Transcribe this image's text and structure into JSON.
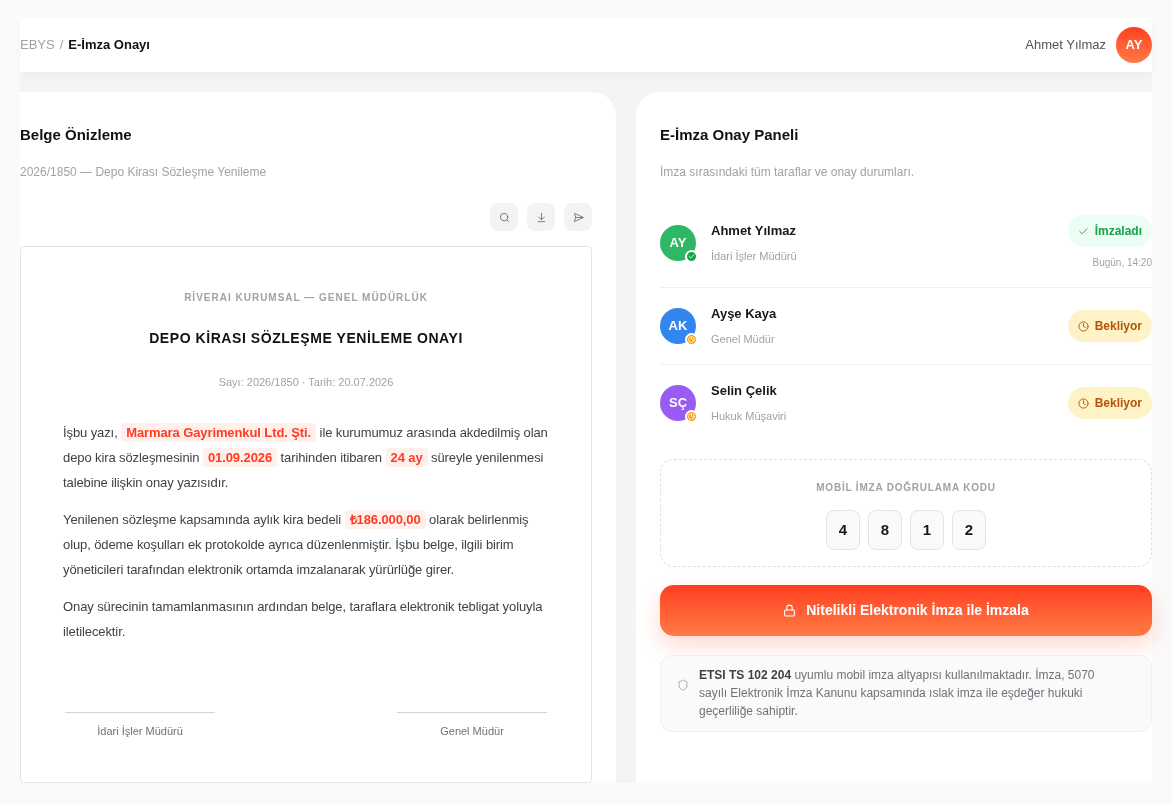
{
  "breadcrumb": {
    "root": "EBYS",
    "separator": "/",
    "current": "E-İmza Onayı"
  },
  "user": {
    "name": "Ahmet Yılmaz",
    "initials": "AY"
  },
  "preview": {
    "title": "Belge Önizleme",
    "subtitle": "2026/1850 — Depo Kirası Sözleşme Yenileme",
    "toolbar": [
      {
        "kind": "zoom"
      },
      {
        "kind": "download"
      },
      {
        "kind": "send"
      }
    ],
    "document": {
      "org": "RİVERAI KURUMSAL — GENEL MÜDÜRLÜK",
      "title": "DEPO KİRASI SÖZLEŞME YENİLEME ONAYI",
      "meta": "Sayı: 2026/1850 · Tarih: 20.07.2026",
      "paragraphs": [
        "İşbu yazı, **Marmara Gayrimenkul Ltd. Şti.** ile kurumumuz arasında akdedilmiş olan depo kira sözleşmesinin **01.09.2026** tarihinden itibaren **24 ay** süreyle yenilenmesi talebine ilişkin onay yazısıdır.",
        "Yenilenen sözleşme kapsamında aylık kira bedeli **₺186.000,00** olarak belirlenmiş olup, ödeme koşulları ek protokolde ayrıca düzenlenmiştir. İşbu belge, ilgili birim yöneticileri tarafından elektronik ortamda imzalanarak yürürlüğe girer.",
        "Onay sürecinin tamamlanmasının ardından belge, taraflara elektronik tebligat yoluyla iletilecektir."
      ],
      "signatures": [
        "İdari İşler Müdürü",
        "Genel Müdür"
      ]
    }
  },
  "panel": {
    "title": "E-İmza Onay Paneli",
    "subtitle": "İmza sırasındaki tüm taraflar ve onay durumları.",
    "signers": [
      {
        "initials": "AY",
        "name": "Ahmet Yılmaz",
        "role": "İdari İşler Müdürü",
        "color": "#2eb866",
        "signed": true,
        "badge": "İmzaladı",
        "time": "Bugün, 14:20"
      },
      {
        "initials": "AK",
        "name": "Ayşe Kaya",
        "role": "Genel Müdür",
        "color": "#3287ef",
        "signed": false,
        "badge": "Bekliyor"
      },
      {
        "initials": "SÇ",
        "name": "Selin Çelik",
        "role": "Hukuk Müşaviri",
        "color": "#985cf2",
        "signed": false,
        "badge": "Bekliyor"
      }
    ],
    "code": {
      "label": "MOBİL İMZA DOĞRULAMA KODU",
      "digits": [
        "4",
        "8",
        "1",
        "2"
      ]
    },
    "sign_button": {
      "label": "Nitelikli Elektronik İmza ile İmzala"
    },
    "notice": "**ETSI TS 102 204** uyumlu mobil imza altyapısı kullanılmaktadır. İmza, 5070 sayılı Elektronik İmza Kanunu kapsamında ıslak imza ile eşdeğer hukuki geçerliliğe sahiptir."
  }
}
